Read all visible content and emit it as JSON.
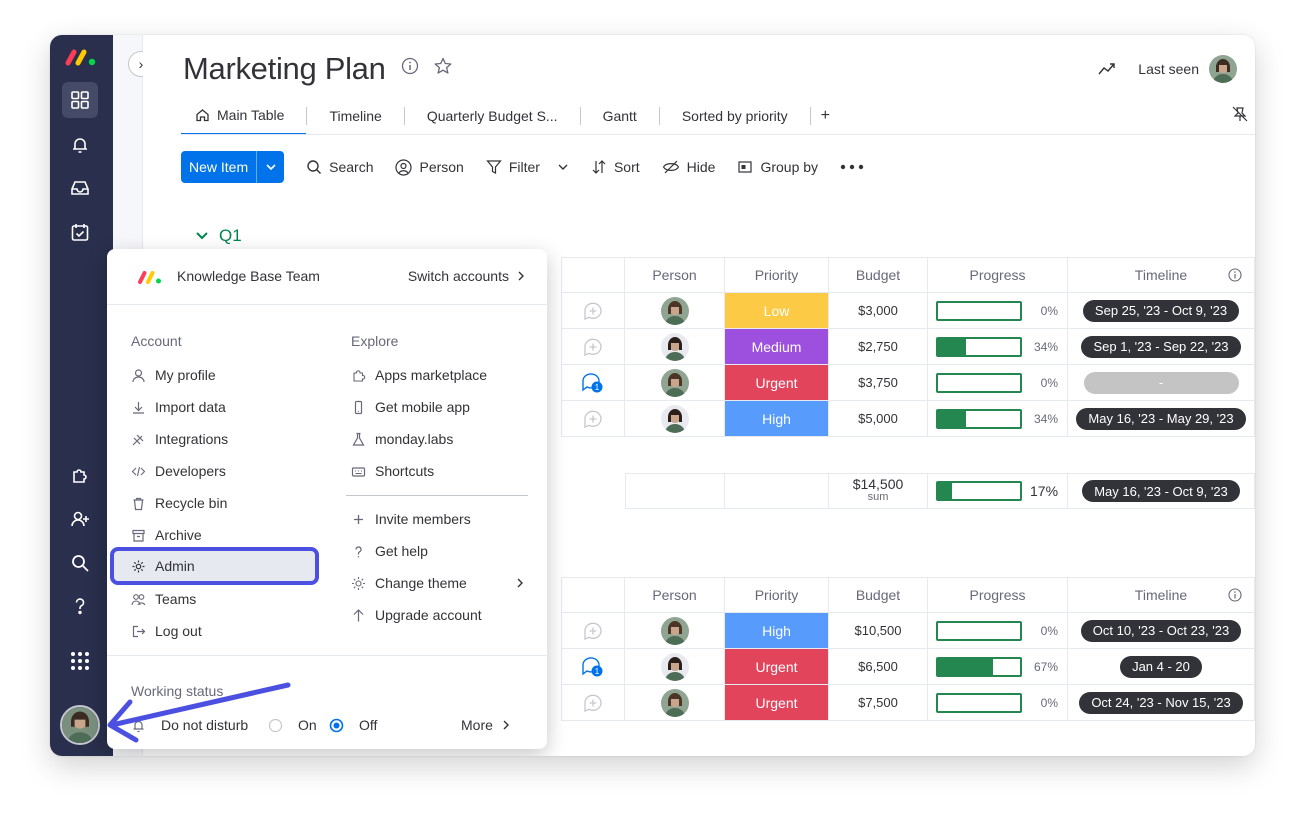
{
  "sidebar": {
    "items": [
      "apps-icon",
      "bell-icon",
      "inbox-icon",
      "my-work-icon"
    ],
    "bottom": [
      "puzzle-icon",
      "invite-icon",
      "search-icon",
      "help-icon",
      "grid-icon"
    ]
  },
  "board": {
    "title": "Marketing Plan",
    "last_seen": "Last seen"
  },
  "tabs": [
    {
      "label": "Main Table"
    },
    {
      "label": "Timeline"
    },
    {
      "label": "Quarterly Budget S..."
    },
    {
      "label": "Gantt"
    },
    {
      "label": "Sorted by priority"
    },
    {
      "label": "+"
    }
  ],
  "toolbar": {
    "new_item": "New Item",
    "search": "Search",
    "person": "Person",
    "filter": "Filter",
    "sort": "Sort",
    "hide": "Hide",
    "group_by": "Group by"
  },
  "group1": {
    "name": "Q1"
  },
  "columns": {
    "person": "Person",
    "priority": "Priority",
    "budget": "Budget",
    "progress": "Progress",
    "timeline": "Timeline"
  },
  "rows1": [
    {
      "priority": "Low",
      "priority_color": "#fdca45",
      "budget": "$3,000",
      "progress": 0,
      "progress_label": "0%",
      "timeline": "Sep 25, '23 - Oct 9, '23",
      "updates": ""
    },
    {
      "priority": "Medium",
      "priority_color": "#9d50dd",
      "budget": "$2,750",
      "progress": 34,
      "progress_label": "34%",
      "timeline": "Sep 1, '23 - Sep 22, '23",
      "updates": ""
    },
    {
      "priority": "Urgent",
      "priority_color": "#e2445c",
      "budget": "$3,750",
      "progress": 0,
      "progress_label": "0%",
      "timeline": "-",
      "updates": "1"
    },
    {
      "priority": "High",
      "priority_color": "#579bfc",
      "budget": "$5,000",
      "progress": 34,
      "progress_label": "34%",
      "timeline": "May 16, '23 - May 29, '23",
      "updates": ""
    }
  ],
  "summary1": {
    "budget": "$14,500",
    "budget_sub": "sum",
    "progress": 17,
    "progress_label": "17%",
    "timeline": "May 16, '23 - Oct 9, '23"
  },
  "rows2": [
    {
      "priority": "High",
      "priority_color": "#579bfc",
      "budget": "$10,500",
      "progress": 0,
      "progress_label": "0%",
      "timeline": "Oct 10, '23 - Oct 23, '23",
      "updates": ""
    },
    {
      "priority": "Urgent",
      "priority_color": "#e2445c",
      "budget": "$6,500",
      "progress": 67,
      "progress_label": "67%",
      "timeline": "Jan 4 - 20",
      "updates": "1"
    },
    {
      "priority": "Urgent",
      "priority_color": "#e2445c",
      "budget": "$7,500",
      "progress": 0,
      "progress_label": "0%",
      "timeline": "Oct 24, '23 - Nov 15, '23",
      "updates": ""
    }
  ],
  "menu": {
    "team": "Knowledge Base Team",
    "switch": "Switch accounts",
    "account_title": "Account",
    "explore_title": "Explore",
    "account": [
      "My profile",
      "Import data",
      "Integrations",
      "Developers",
      "Recycle bin",
      "Archive",
      "Admin",
      "Teams",
      "Log out"
    ],
    "explore": [
      "Apps marketplace",
      "Get mobile app",
      "monday.labs",
      "Shortcuts"
    ],
    "more": [
      "Invite members",
      "Get help",
      "Change theme",
      "Upgrade account"
    ],
    "working_status": "Working status",
    "dnd": "Do not disturb",
    "on": "On",
    "off": "Off",
    "more_link": "More"
  },
  "colors": {
    "accent": "#0073ea",
    "sidebar": "#292f4c",
    "highlight": "#4b50e0",
    "progress": "#258750"
  }
}
